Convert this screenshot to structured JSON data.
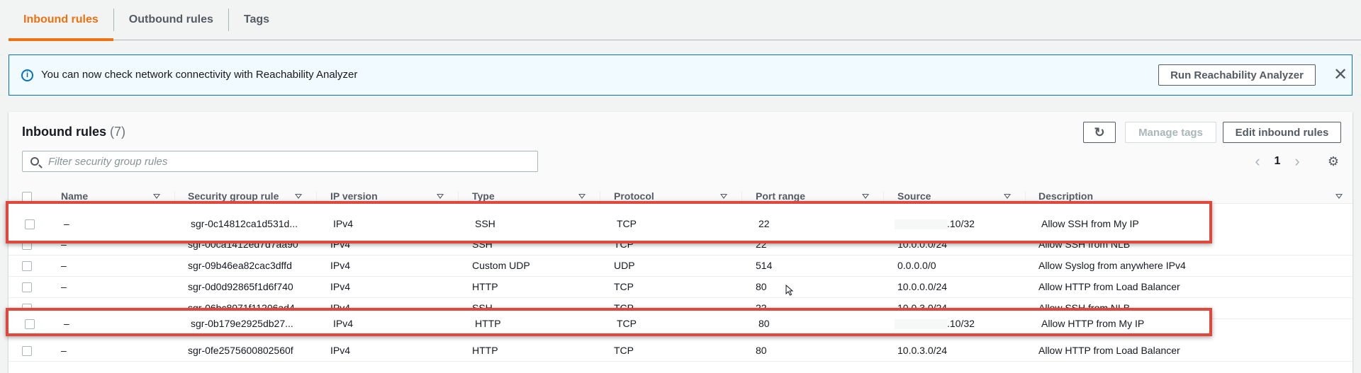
{
  "tabs": [
    {
      "label": "Inbound rules",
      "active": true
    },
    {
      "label": "Outbound rules",
      "active": false
    },
    {
      "label": "Tags",
      "active": false
    }
  ],
  "flash": {
    "icon": "info-icon",
    "message": "You can now check network connectivity with Reachability Analyzer",
    "button_label": "Run Reachability Analyzer",
    "close_glyph": "✕"
  },
  "panel": {
    "title": "Inbound rules",
    "count": "(7)",
    "refresh_glyph": "↻",
    "manage_tags_label": "Manage tags",
    "edit_label": "Edit inbound rules",
    "search_placeholder": "Filter security group rules",
    "page_number": "1",
    "prev_glyph": "‹",
    "next_glyph": "›",
    "settings_glyph": "⚙"
  },
  "table": {
    "columns": [
      "Name",
      "Security group rule",
      "IP version",
      "Type",
      "Protocol",
      "Port range",
      "Source",
      "Description"
    ],
    "rows": [
      {
        "name": "–",
        "rule": "sgr-0c14812ca1d531d...",
        "ip": "IPv4",
        "type": "SSH",
        "protocol": "TCP",
        "port": "22",
        "source": ".10/32",
        "source_masked": true,
        "description": "Allow SSH from My IP",
        "highlighted": true
      },
      {
        "name": "–",
        "rule": "sgr-00ca1412ed7d7aa90",
        "ip": "IPv4",
        "type": "SSH",
        "protocol": "TCP",
        "port": "22",
        "source": "10.0.0.0/24",
        "source_masked": false,
        "description": "Allow SSH from NLB",
        "highlighted": false
      },
      {
        "name": "–",
        "rule": "sgr-09b46ea82cac3dffd",
        "ip": "IPv4",
        "type": "Custom UDP",
        "protocol": "UDP",
        "port": "514",
        "source": "0.0.0.0/0",
        "source_masked": false,
        "description": "Allow Syslog from anywhere IPv4",
        "highlighted": false
      },
      {
        "name": "–",
        "rule": "sgr-0d0d92865f1d6f740",
        "ip": "IPv4",
        "type": "HTTP",
        "protocol": "TCP",
        "port": "80",
        "source": "10.0.0.0/24",
        "source_masked": false,
        "description": "Allow HTTP from Load Balancer",
        "highlighted": false
      },
      {
        "name": "–",
        "rule": "sgr-06bc8071f11206ad4",
        "ip": "IPv4",
        "type": "SSH",
        "protocol": "TCP",
        "port": "22",
        "source": "10.0.3.0/24",
        "source_masked": false,
        "description": "Allow SSH from NLB",
        "highlighted": false
      },
      {
        "name": "–",
        "rule": "sgr-0b179e2925db27...",
        "ip": "IPv4",
        "type": "HTTP",
        "protocol": "TCP",
        "port": "80",
        "source": ".10/32",
        "source_masked": true,
        "description": "Allow HTTP from My IP",
        "highlighted": true
      },
      {
        "name": "–",
        "rule": "sgr-0fe2575600802560f",
        "ip": "IPv4",
        "type": "HTTP",
        "protocol": "TCP",
        "port": "80",
        "source": "10.0.3.0/24",
        "source_masked": false,
        "description": "Allow HTTP from Load Balancer",
        "highlighted": false
      }
    ]
  },
  "colors": {
    "accent": "#ec7211",
    "info": "#0073bb",
    "highlight_border": "#e0483e"
  }
}
